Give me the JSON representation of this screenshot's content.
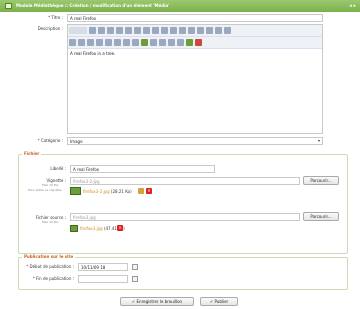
{
  "window": {
    "title": "Module Médiathèque :: Création / modification d'un élément 'Média'",
    "ctrls": "◂ ▸"
  },
  "fields": {
    "title": {
      "label": "Titre :",
      "value": "A real Firefox"
    },
    "description": {
      "label": "Description :",
      "content": "A real Firefox in a tree."
    },
    "category": {
      "label": "Catégorie :",
      "value": "Image"
    }
  },
  "editor": {
    "source_label": "Source"
  },
  "fichier": {
    "section_title": "Fichier",
    "libelle_label": "Libellé :",
    "libelle_value": "A real Firefox",
    "vignette_label": "Vignette :",
    "vignette_sub": "Max 10 Mo",
    "vignette_value": "firefox3-2.jpg",
    "vignette_note": "Pour éditer la vignette",
    "vignette_file": "firefox3-2.jpg",
    "vignette_size": "(28.21 Ko)",
    "source_label": "Fichier source :",
    "source_sub": "Max 10 Mo",
    "source_value": "firefox3.jpg",
    "source_file": "firefox3.jpg",
    "source_size": "(47.41 Ko)",
    "browse": "Parcourir..."
  },
  "publication": {
    "section_title": "Publication sur le site",
    "start_label": "Début de publication :",
    "start_value": "10/11/09 18",
    "end_label": "Fin de publication :",
    "end_value": ""
  },
  "buttons": {
    "save_draft": "Enregistrer le brouillon",
    "publish": "Publier"
  }
}
